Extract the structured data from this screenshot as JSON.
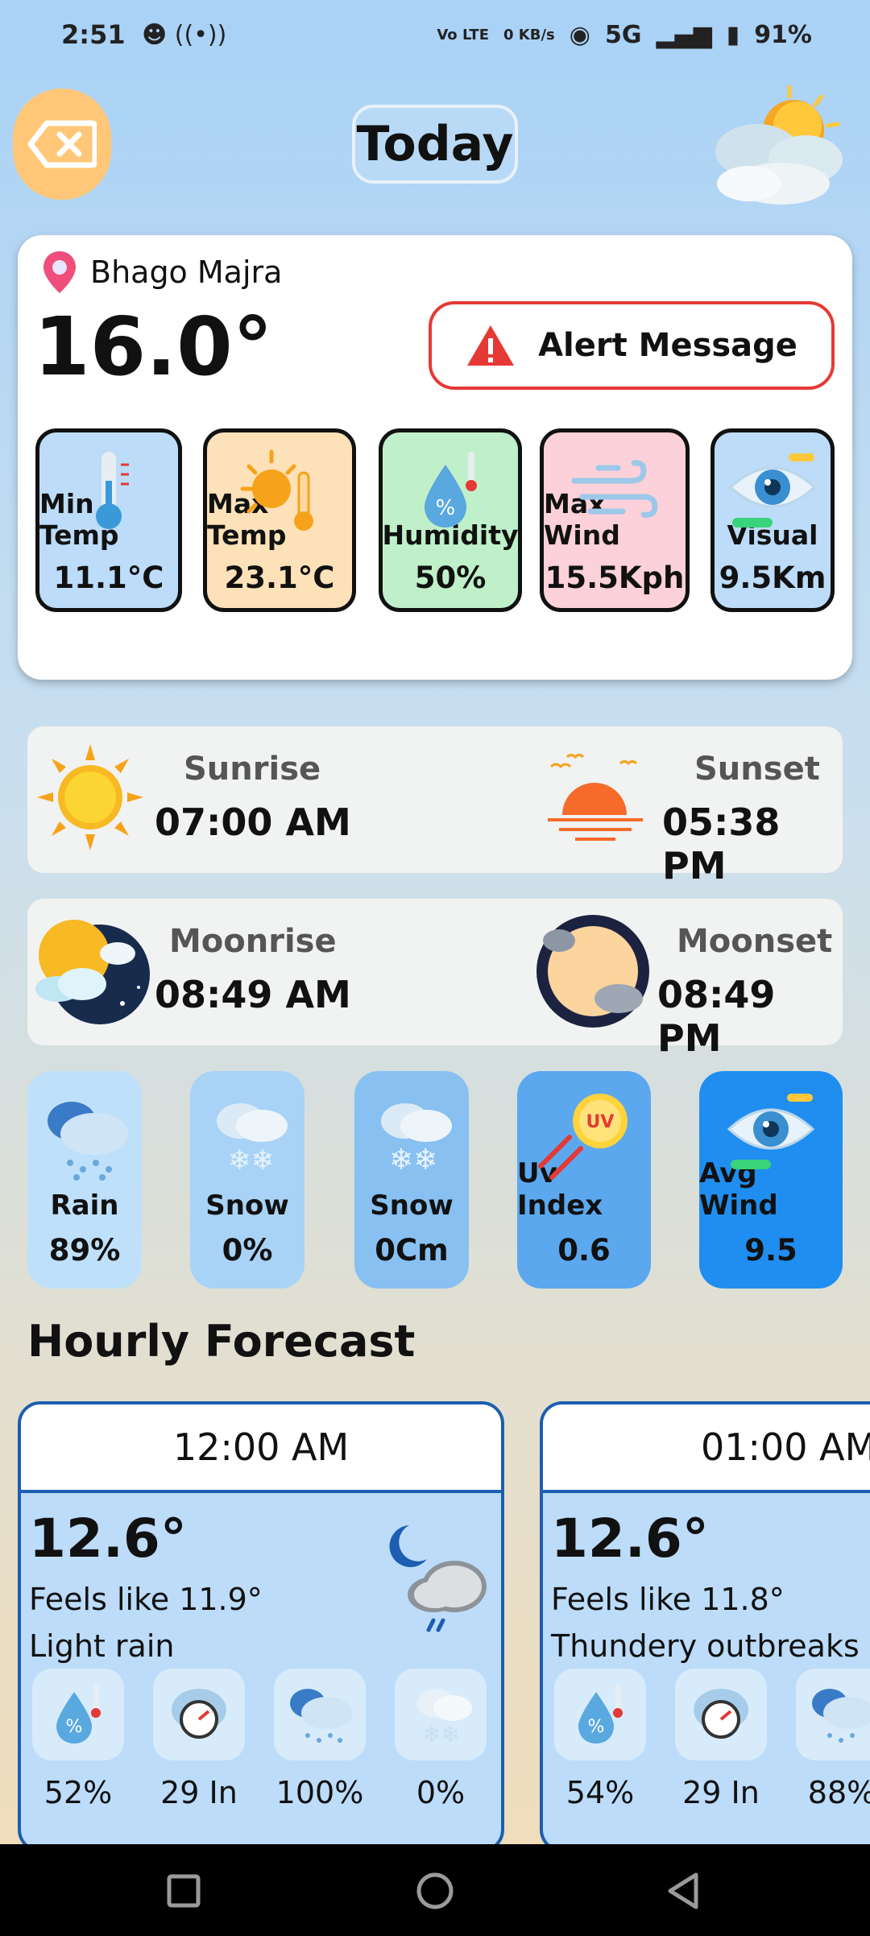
{
  "status_bar": {
    "time": "2:51",
    "net_speed": "0 KB/s",
    "network": "5G",
    "battery": "91%"
  },
  "header": {
    "title": "Today"
  },
  "location": "Bhago Majra",
  "current_temp": "16.0°",
  "alert_label": "Alert Message",
  "stats": [
    {
      "label": "Min Temp",
      "value": "11.1°C"
    },
    {
      "label": "Max Temp",
      "value": "23.1°C"
    },
    {
      "label": "Humidity",
      "value": "50%"
    },
    {
      "label": "Max Wind",
      "value": "15.5Kph"
    },
    {
      "label": "Visual",
      "value": "9.5Km"
    }
  ],
  "sun": {
    "sunrise_label": "Sunrise",
    "sunrise": "07:00 AM",
    "sunset_label": "Sunset",
    "sunset": "05:38 PM"
  },
  "moon": {
    "moonrise_label": "Moonrise",
    "moonrise": "08:49 AM",
    "moonset_label": "Moonset",
    "moonset": "08:49 PM"
  },
  "tiles": [
    {
      "label": "Rain",
      "value": "89%"
    },
    {
      "label": "Snow",
      "value": "0%"
    },
    {
      "label": "Snow",
      "value": "0Cm"
    },
    {
      "label": "Uv Index",
      "value": "0.6"
    },
    {
      "label": "Avg Wind",
      "value": "9.5"
    }
  ],
  "hourly_title": "Hourly Forecast",
  "hourly": [
    {
      "time": "12:00 AM",
      "temp": "12.6°",
      "feels": "Feels like 11.9°",
      "cond": "Light rain",
      "vals": [
        "52%",
        "29 In",
        "100%",
        "0%"
      ]
    },
    {
      "time": "01:00 AM",
      "temp": "12.6°",
      "feels": "Feels like 11.8°",
      "cond": "Thundery outbreaks",
      "vals": [
        "54%",
        "29 In",
        "88%"
      ]
    }
  ],
  "colors": {
    "accent": "#1c5eb1",
    "alert": "#e53935",
    "back_button": "#ffc777"
  }
}
